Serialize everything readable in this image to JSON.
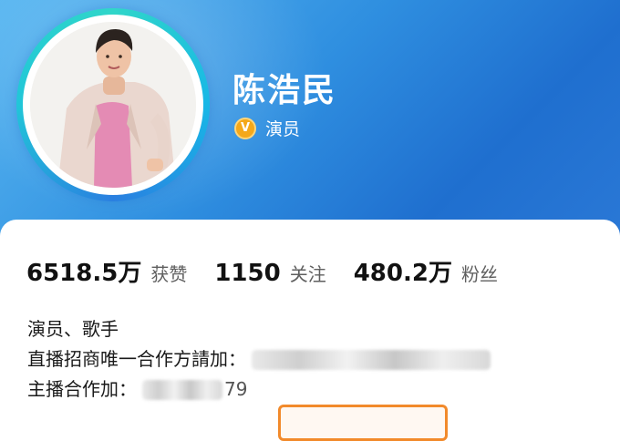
{
  "profile": {
    "name": "陈浩民",
    "verified_title": "演员",
    "verified_badge": "V"
  },
  "stats": [
    {
      "value": "6518.5万",
      "label": "获赞"
    },
    {
      "value": "1150",
      "label": "关注"
    },
    {
      "value": "480.2万",
      "label": "粉丝"
    }
  ],
  "bio": {
    "line1": "演员、歌手",
    "line2_prefix": "直播招商唯一合作方請加：",
    "line3_prefix": "主播合作加：",
    "line3_suffix": "79"
  },
  "colors": {
    "header_blue": "#2f8fe0",
    "badge_gold": "#f4a81a",
    "ring_teal": "#30d6c9",
    "button_orange": "#f28a2b"
  }
}
